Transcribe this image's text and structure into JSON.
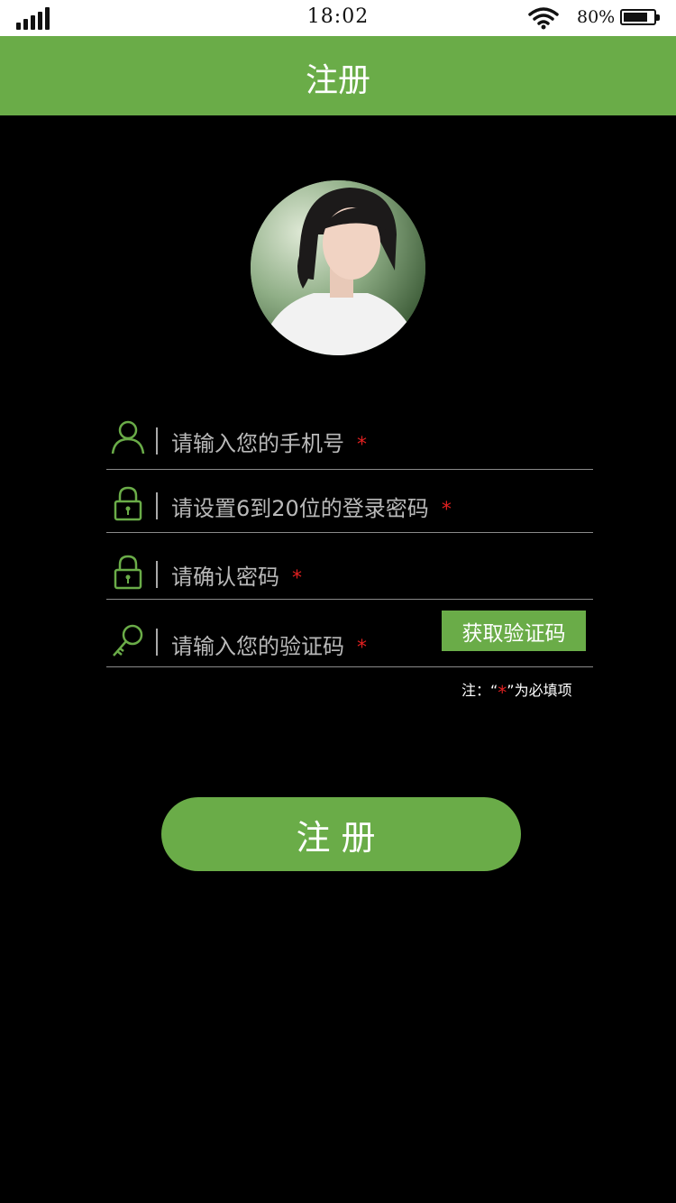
{
  "status_bar": {
    "time": "18:02",
    "battery_percent": "80%",
    "battery_level": 0.8,
    "icons": [
      "signal-icon",
      "wifi-icon",
      "battery-icon"
    ]
  },
  "header": {
    "title": "注册"
  },
  "form": {
    "phone_placeholder": "请输入您的手机号",
    "password_placeholder": "请设置6到20位的登录密码",
    "confirm_placeholder": "请确认密码",
    "code_placeholder": "请输入您的验证码",
    "required_mark": "*",
    "get_code_label": "获取验证码",
    "note_prefix": "注：“",
    "note_suffix": "”为必填项"
  },
  "register_label": "注册",
  "colors": {
    "accent": "#6aac48",
    "required": "#e02020",
    "background": "#000000"
  }
}
